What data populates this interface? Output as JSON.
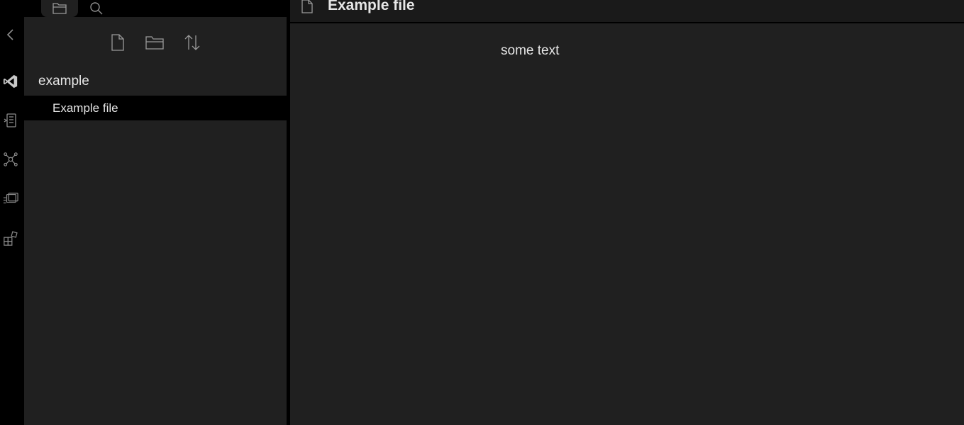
{
  "ribbon": {
    "icons": [
      "collapse-chevron-icon",
      "vscode-icon",
      "outline-icon",
      "graph-icon",
      "cards-icon",
      "plugins-icon"
    ]
  },
  "sidebar": {
    "tabs": [
      "file-explorer-icon",
      "search-icon"
    ],
    "nav_buttons": [
      "new-note-icon",
      "new-folder-icon",
      "sort-icon"
    ],
    "folder": "example",
    "files": [
      {
        "label": "Example file",
        "active": true
      }
    ]
  },
  "main": {
    "header_title": "Example file",
    "content": "some text"
  },
  "colors": {
    "ribbon_bg": "#000000",
    "sidebar_bg": "#202020",
    "editor_bg": "#202020",
    "active_item_bg": "#000000",
    "text": "#e6e6e6",
    "icon": "#8c8c8c"
  }
}
